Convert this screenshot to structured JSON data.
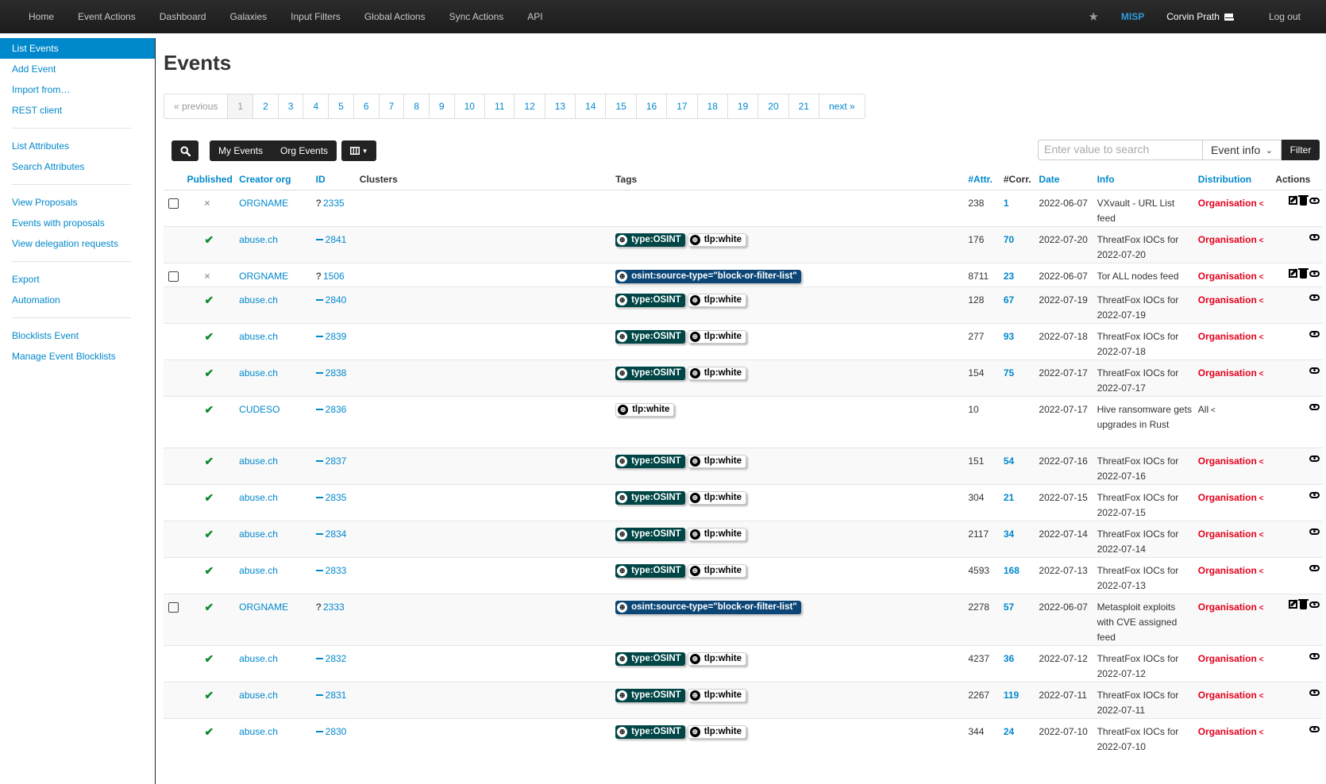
{
  "topnav": {
    "items": [
      "Home",
      "Event Actions",
      "Dashboard",
      "Galaxies",
      "Input Filters",
      "Global Actions",
      "Sync Actions",
      "API"
    ],
    "star_icon": "star-icon",
    "brand": "MISP",
    "user": "Corvin Prath",
    "logout": "Log out"
  },
  "sidebar": {
    "groups": [
      [
        "List Events",
        "Add Event",
        "Import from…",
        "REST client"
      ],
      [
        "List Attributes",
        "Search Attributes"
      ],
      [
        "View Proposals",
        "Events with proposals",
        "View delegation requests"
      ],
      [
        "Export",
        "Automation"
      ],
      [
        "Blocklists Event",
        "Manage Event Blocklists"
      ]
    ],
    "active": "List Events"
  },
  "page": {
    "title": "Events"
  },
  "pagination": {
    "prev": "« previous",
    "pages": [
      "1",
      "2",
      "3",
      "4",
      "5",
      "6",
      "7",
      "8",
      "9",
      "10",
      "11",
      "12",
      "13",
      "14",
      "15",
      "16",
      "17",
      "18",
      "19",
      "20",
      "21"
    ],
    "next": "next »",
    "current": "1"
  },
  "toolbar": {
    "my_events": "My Events",
    "org_events": "Org Events",
    "search_placeholder": "Enter value to search",
    "search_field": "Event info",
    "filter": "Filter"
  },
  "table": {
    "headers": {
      "published": "Published",
      "creator": "Creator org",
      "id": "ID",
      "clusters": "Clusters",
      "tags": "Tags",
      "attr": "#Attr.",
      "corr": "#Corr.",
      "date": "Date",
      "info": "Info",
      "distribution": "Distribution",
      "actions": "Actions"
    },
    "rows": [
      {
        "checkbox": true,
        "published": "×",
        "org": "ORGNAME",
        "id_mark": "?",
        "id": "2335",
        "tags": [],
        "attr": "238",
        "corr": "1",
        "date": "2022-06-07",
        "info": "VXvault - URL List feed",
        "dist": "Organisation",
        "edit": true
      },
      {
        "checkbox": false,
        "published": "✔",
        "org": "abuse.ch",
        "id_mark": "—",
        "id": "2841",
        "tags": [
          "type:OSINT",
          "tlp:white"
        ],
        "attr": "176",
        "corr": "70",
        "date": "2022-07-20",
        "info": "ThreatFox IOCs for 2022-07-20",
        "dist": "Organisation",
        "edit": false
      },
      {
        "checkbox": true,
        "published": "×",
        "org": "ORGNAME",
        "id_mark": "?",
        "id": "1506",
        "tags": [
          "osint:source-type=\"block-or-filter-list\""
        ],
        "attr": "8711",
        "corr": "23",
        "date": "2022-06-07",
        "info": "Tor ALL nodes feed",
        "dist": "Organisation",
        "edit": true
      },
      {
        "checkbox": false,
        "published": "✔",
        "org": "abuse.ch",
        "id_mark": "—",
        "id": "2840",
        "tags": [
          "type:OSINT",
          "tlp:white"
        ],
        "attr": "128",
        "corr": "67",
        "date": "2022-07-19",
        "info": "ThreatFox IOCs for 2022-07-19",
        "dist": "Organisation",
        "edit": false
      },
      {
        "checkbox": false,
        "published": "✔",
        "org": "abuse.ch",
        "id_mark": "—",
        "id": "2839",
        "tags": [
          "type:OSINT",
          "tlp:white"
        ],
        "attr": "277",
        "corr": "93",
        "date": "2022-07-18",
        "info": "ThreatFox IOCs for 2022-07-18",
        "dist": "Organisation",
        "edit": false
      },
      {
        "checkbox": false,
        "published": "✔",
        "org": "abuse.ch",
        "id_mark": "—",
        "id": "2838",
        "tags": [
          "type:OSINT",
          "tlp:white"
        ],
        "attr": "154",
        "corr": "75",
        "date": "2022-07-17",
        "info": "ThreatFox IOCs for 2022-07-17",
        "dist": "Organisation",
        "edit": false
      },
      {
        "checkbox": false,
        "published": "✔",
        "org": "CUDESO",
        "id_mark": "—",
        "id": "2836",
        "tags": [
          "tlp:white"
        ],
        "attr": "10",
        "corr": "",
        "date": "2022-07-17",
        "info": "Hive ransomware gets upgrades in Rust",
        "dist": "All",
        "edit": false
      },
      {
        "checkbox": false,
        "published": "✔",
        "org": "abuse.ch",
        "id_mark": "—",
        "id": "2837",
        "tags": [
          "type:OSINT",
          "tlp:white"
        ],
        "attr": "151",
        "corr": "54",
        "date": "2022-07-16",
        "info": "ThreatFox IOCs for 2022-07-16",
        "dist": "Organisation",
        "edit": false
      },
      {
        "checkbox": false,
        "published": "✔",
        "org": "abuse.ch",
        "id_mark": "—",
        "id": "2835",
        "tags": [
          "type:OSINT",
          "tlp:white"
        ],
        "attr": "304",
        "corr": "21",
        "date": "2022-07-15",
        "info": "ThreatFox IOCs for 2022-07-15",
        "dist": "Organisation",
        "edit": false
      },
      {
        "checkbox": false,
        "published": "✔",
        "org": "abuse.ch",
        "id_mark": "—",
        "id": "2834",
        "tags": [
          "type:OSINT",
          "tlp:white"
        ],
        "attr": "2117",
        "corr": "34",
        "date": "2022-07-14",
        "info": "ThreatFox IOCs for 2022-07-14",
        "dist": "Organisation",
        "edit": false
      },
      {
        "checkbox": false,
        "published": "✔",
        "org": "abuse.ch",
        "id_mark": "—",
        "id": "2833",
        "tags": [
          "type:OSINT",
          "tlp:white"
        ],
        "attr": "4593",
        "corr": "168",
        "date": "2022-07-13",
        "info": "ThreatFox IOCs for 2022-07-13",
        "dist": "Organisation",
        "edit": false
      },
      {
        "checkbox": true,
        "published": "✔",
        "org": "ORGNAME",
        "id_mark": "?",
        "id": "2333",
        "tags": [
          "osint:source-type=\"block-or-filter-list\""
        ],
        "attr": "2278",
        "corr": "57",
        "date": "2022-06-07",
        "info": "Metasploit exploits with CVE assigned feed",
        "dist": "Organisation",
        "edit": true
      },
      {
        "checkbox": false,
        "published": "✔",
        "org": "abuse.ch",
        "id_mark": "—",
        "id": "2832",
        "tags": [
          "type:OSINT",
          "tlp:white"
        ],
        "attr": "4237",
        "corr": "36",
        "date": "2022-07-12",
        "info": "ThreatFox IOCs for 2022-07-12",
        "dist": "Organisation",
        "edit": false
      },
      {
        "checkbox": false,
        "published": "✔",
        "org": "abuse.ch",
        "id_mark": "—",
        "id": "2831",
        "tags": [
          "type:OSINT",
          "tlp:white"
        ],
        "attr": "2267",
        "corr": "119",
        "date": "2022-07-11",
        "info": "ThreatFox IOCs for 2022-07-11",
        "dist": "Organisation",
        "edit": false
      },
      {
        "checkbox": false,
        "published": "✔",
        "org": "abuse.ch",
        "id_mark": "—",
        "id": "2830",
        "tags": [
          "type:OSINT",
          "tlp:white"
        ],
        "attr": "344",
        "corr": "24",
        "date": "2022-07-10",
        "info": "ThreatFox IOCs for 2022-07-10",
        "dist": "Organisation",
        "edit": false
      }
    ]
  }
}
